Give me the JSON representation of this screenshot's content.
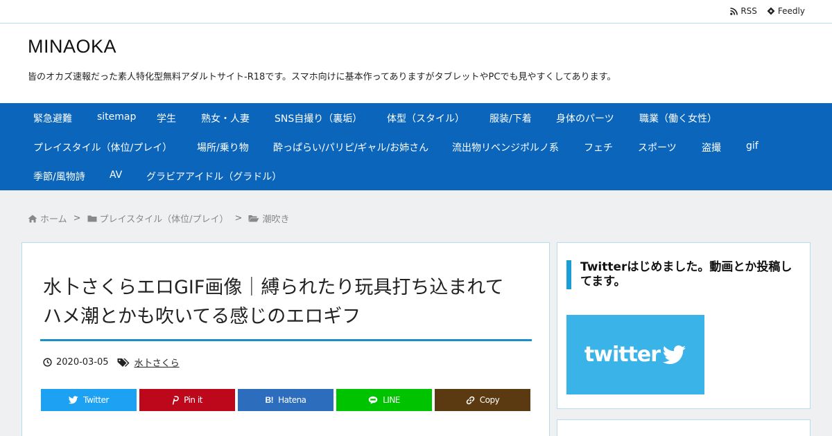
{
  "topbar": {
    "rss_label": "RSS",
    "feedly_label": "Feedly"
  },
  "header": {
    "title": "MINAOKA",
    "description": "皆のオカズ速報だった素人特化型無料アダルトサイト-R18です。スマホ向けに基本作ってありますがタブレットやPCでも見やすくしてあります。"
  },
  "nav": {
    "items": [
      "緊急避難",
      "sitemap",
      "学生",
      "熟女・人妻",
      "SNS自撮り（裏垢）",
      "体型（スタイル）",
      "服装/下着",
      "身体のパーツ",
      "職業（働く女性）",
      "プレイスタイル（体位/プレイ）",
      "場所/乗り物",
      "酔っぱらい/パリピ/ギャル/お姉さん",
      "流出物リベンジポルノ系",
      "フェチ",
      "スポーツ",
      "盗撮",
      "gif",
      "季節/風物詩",
      "AV",
      "グラビアアイドル（グラドル）"
    ]
  },
  "breadcrumb": {
    "home": "ホーム",
    "category": "プレイスタイル（体位/プレイ）",
    "subcategory": "潮吹き",
    "separator": ">"
  },
  "article": {
    "title": "水卜さくらエロGIF画像｜縛られたり玩具打ち込まれてハメ潮とかも吹いてる感じのエロギフ",
    "date": "2020-03-05",
    "tag": "水卜さくら"
  },
  "share": {
    "twitter": "Twitter",
    "pinit": "Pin it",
    "hatena": "Hatena",
    "line": "LINE",
    "copy": "Copy"
  },
  "sidebar": {
    "widget_title": "Twitterはじめました。動画とか投稿してます。",
    "banner_text": "twitter"
  },
  "colors": {
    "nav_bg": "#0a65bb",
    "accent": "#1b8fc7",
    "twitter": "#1da1f2",
    "pinterest": "#bd081c",
    "hatena": "#2c6ebd",
    "line": "#00c300",
    "copy": "#5b3a11",
    "banner": "#3ab3e9"
  }
}
